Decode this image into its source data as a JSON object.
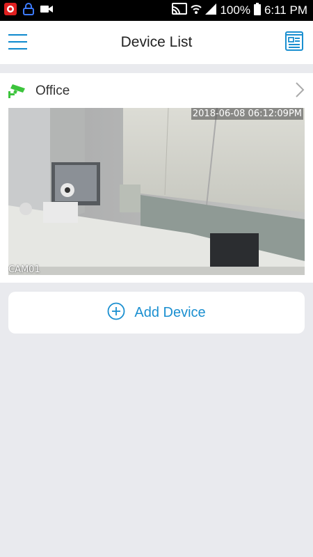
{
  "status_bar": {
    "battery": "100%",
    "time": "6:11 PM"
  },
  "header": {
    "title": "Device List"
  },
  "device": {
    "name": "Office",
    "timestamp": "2018-06-08 06:12:09PM",
    "camera_label": "CAM01"
  },
  "actions": {
    "add_device": "Add Device"
  },
  "colors": {
    "accent": "#1a8fd0",
    "online": "#3cc43c"
  }
}
